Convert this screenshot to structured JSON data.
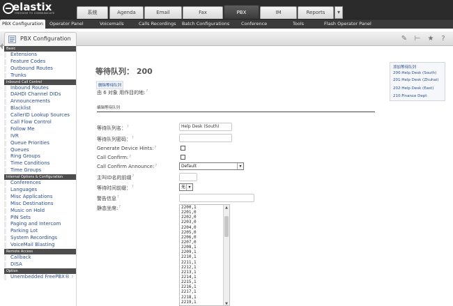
{
  "header": {
    "logo_text": "elastix",
    "logo_tagline": "FREEDOM TO COMMUNICATE",
    "tabs": [
      "系统",
      "Agenda",
      "Email",
      "Fax",
      "PBX",
      "IM",
      "Reports"
    ],
    "active_tab": "PBX"
  },
  "subnav": {
    "items": [
      "PBX Configuration",
      "Operator Panel",
      "Voicemails",
      "Calls Recordings",
      "Batch Configurations",
      "Conference",
      "Tools",
      "Flash Operator Panel"
    ],
    "active": "PBX Configuration"
  },
  "module": {
    "title": "PBX Configuration"
  },
  "sidebar": {
    "sections": [
      {
        "header": "Basic",
        "items": [
          "Extensions",
          "Feature Codes",
          "Outbound Routes",
          "Trunks"
        ]
      },
      {
        "header": "Inbound Call Control",
        "items": [
          "Inbound Routes",
          "DAHDI Channel DIDs",
          "Announcements",
          "Blacklist",
          "CallerID Lookup Sources",
          "Call Flow Control",
          "Follow Me",
          "IVR",
          "Queue Priorities",
          "Queues",
          "Ring Groups",
          "Time Conditions",
          "Time Groups"
        ]
      },
      {
        "header": "Internal Options & Configuration",
        "items": [
          "Conferences",
          "Languages",
          "Misc Applications",
          "Misc Destinations",
          "Music on Hold",
          "PIN Sets",
          "Paging and Intercom",
          "Parking Lot",
          "System Recordings",
          "VoiceMail Blasting"
        ]
      },
      {
        "header": "Remote Access",
        "items": [
          "Callback",
          "DISA"
        ]
      },
      {
        "header": "Option",
        "items": [
          "Unembedded FreePBX®"
        ]
      }
    ]
  },
  "form": {
    "heading": "等待队列： 200",
    "delete_label": "删除等待队列",
    "used_by": "由 6 对象 用作目的地:",
    "section_label": "编辑等待队列",
    "help_mark": "?",
    "fields": {
      "queue_name": {
        "label": "等待队列名：",
        "value": "Help Desk (South)"
      },
      "queue_password": {
        "label": "等待队列密码：",
        "value": ""
      },
      "generate_hints": {
        "label": "Generate Device Hints:",
        "checked": false
      },
      "call_confirm": {
        "label": "Call Confirm:",
        "checked": false
      },
      "call_confirm_announce": {
        "label": "Call Confirm Announce:",
        "value": "Default"
      },
      "cid_prefix": {
        "label": "主叫ID名的前缀",
        "value": ""
      },
      "wait_time_prefix": {
        "label": "等待时间前缀：",
        "value": "无"
      },
      "alert_info": {
        "label": "警告信息",
        "value": ""
      },
      "static_agents": {
        "label": "静态坐席:",
        "lines": [
          "2200,1",
          "2201,0",
          "2202,0",
          "2203,0",
          "2204,0",
          "2205,0",
          "2206,0",
          "2207,0",
          "2208,1",
          "2209,1",
          "2210,1",
          "2211,1",
          "2212,1",
          "2213,1",
          "2214,1",
          "2215,1",
          "2216,1",
          "2217,1",
          "2218,1",
          "2219,1"
        ]
      }
    }
  },
  "queue_list": {
    "add_label": "添加等待队列",
    "items": [
      "200:Help Desk (South)",
      "201:Help Desk (Zhuhai)",
      "202:Help Desk (East)",
      "210:Finance Dept"
    ]
  }
}
